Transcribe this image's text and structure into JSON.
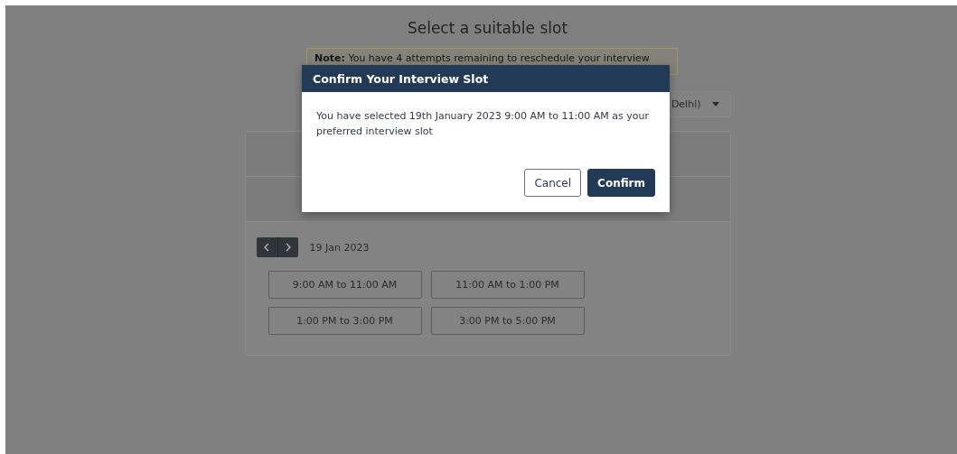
{
  "page": {
    "title": "Select a suitable slot",
    "note": {
      "label": "Note:",
      "text": "You have 4 attempts remaining to reschedule your interview"
    },
    "timezone": {
      "value": "Delhi)"
    },
    "date": "19 Jan 2023",
    "nav": [
      {
        "kind": "prev"
      },
      {
        "kind": "next"
      }
    ],
    "slots": [
      {
        "label": "9:00 AM to 11:00 AM"
      },
      {
        "label": "11:00 AM to 1:00 PM"
      },
      {
        "label": "1:00 PM to 3:00 PM"
      },
      {
        "label": "3:00 PM to 5:00 PM"
      }
    ]
  },
  "dialog": {
    "title": "Confirm Your Interview Slot",
    "message": "You have selected 19th January 2023 9:00 AM to 11:00 AM as your preferred interview slot",
    "buttons": [
      {
        "kind": "secondary",
        "label": "Cancel"
      },
      {
        "kind": "primary",
        "label": "Confirm"
      }
    ]
  }
}
